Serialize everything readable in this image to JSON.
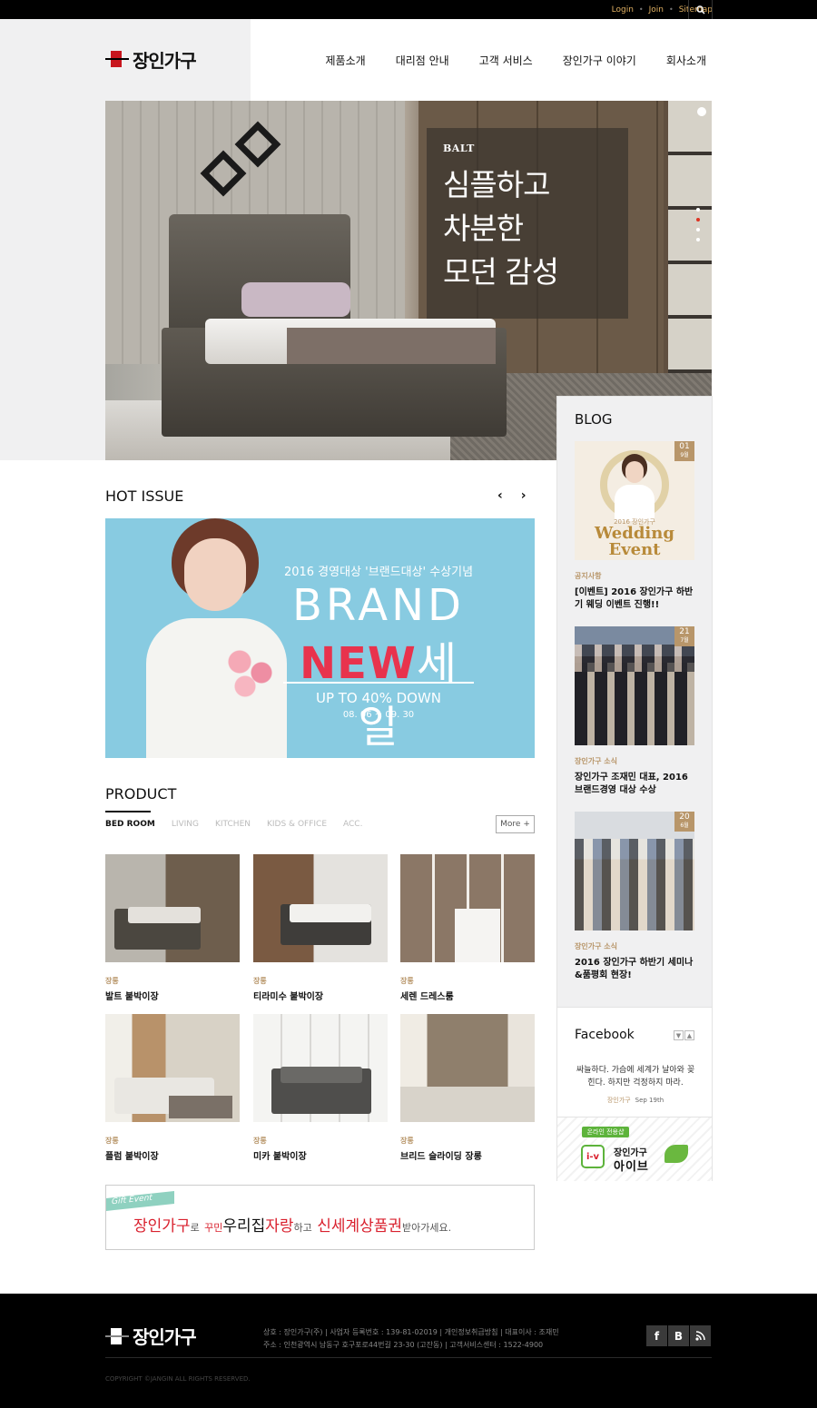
{
  "topbar": {
    "links": [
      "Login",
      "Join",
      "Sitemap"
    ],
    "search_icon": "search-icon"
  },
  "header": {
    "logo_text": "장인가구",
    "nav": [
      "제품소개",
      "대리점 안내",
      "고객 서비스",
      "장인가구 이야기",
      "회사소개"
    ]
  },
  "hero": {
    "brand": "BALT",
    "lines": [
      "심플하고",
      "차분한",
      "모던 감성"
    ]
  },
  "hot_issue": {
    "title": "HOT ISSUE",
    "prev_icon": "chevron-left-icon",
    "next_icon": "chevron-right-icon",
    "banner": {
      "headline": "2016 경영대상 '브랜드대상' 수상기념",
      "brand": "BRAND",
      "new": "NEW",
      "sale": "세일",
      "discount": "UP TO 40% DOWN",
      "period": "08. 06 ~ 09. 30"
    }
  },
  "product": {
    "title": "PRODUCT",
    "tabs": [
      "BED ROOM",
      "LIVING",
      "KITCHEN",
      "KIDS & OFFICE",
      "ACC."
    ],
    "more_label": "More +",
    "items": [
      {
        "category": "장롱",
        "name": "발트 붙박이장"
      },
      {
        "category": "장롱",
        "name": "티라미수 붙박이장"
      },
      {
        "category": "장롱",
        "name": "세렌 드레스룸"
      },
      {
        "category": "장롱",
        "name": "플럼 붙박이장"
      },
      {
        "category": "장롱",
        "name": "미카 붙박이장"
      },
      {
        "category": "장롱",
        "name": "브리드 슬라이딩 장롱"
      }
    ]
  },
  "gift_banner": {
    "tag": "Gift Event",
    "part1": "장인가구",
    "part2": "로",
    "part3": "꾸민",
    "part4": "우리집",
    "part5": "자랑",
    "part6": "하고",
    "part7": "신세계상품권",
    "part8": "받아가세요."
  },
  "blog": {
    "title": "BLOG",
    "items": [
      {
        "day": "01",
        "month": "9월",
        "category": "공지사항",
        "title": "[이벤트] 2016 장인가구 하반기 웨딩 이벤트 진행!!"
      },
      {
        "day": "21",
        "month": "7월",
        "category": "장인가구 소식",
        "title": "장인가구 조재민 대표, 2016 브랜드경영 대상 수상"
      },
      {
        "day": "20",
        "month": "6월",
        "category": "장인가구 소식",
        "title": "2016 장인가구 하반기 세미나&품평회 현장!"
      }
    ],
    "wedding_label_small": "2016 장인가구",
    "wedding_label": "Wedding",
    "wedding_label2": "Event"
  },
  "facebook": {
    "title": "Facebook",
    "post": "싸늘하다. 가슴에 세계가 날아와 꽂힌다. 하지만 걱정하지 마라.",
    "user": "장인가구",
    "date": "Sep 19th"
  },
  "ive": {
    "badge": "온라인 전용샵",
    "line1": "장인가구",
    "line2": "아이브",
    "icon_text": "i-v"
  },
  "footer": {
    "logo_text": "장인가구",
    "info_line1": "상호 : 장인가구(주)  |  사업자 등록번호 : 139-81-02019  |  개인정보취급방침  |  대표이사 : 조재민",
    "info_line2": "주소 : 인천광역시 남동구 호구포로44번길 23-30 (고잔동)  |  고객서비스센터 : 1522-4900",
    "copyright": "COPYRIGHT ©JANGIN ALL RIGHTS RESERVED.",
    "sns": [
      "f",
      "B",
      "rss"
    ]
  },
  "colors": {
    "accent_gold": "#b8966a",
    "brand_red": "#c8161e",
    "banner_blue": "#88cbe1",
    "new_red": "#e8334d"
  }
}
